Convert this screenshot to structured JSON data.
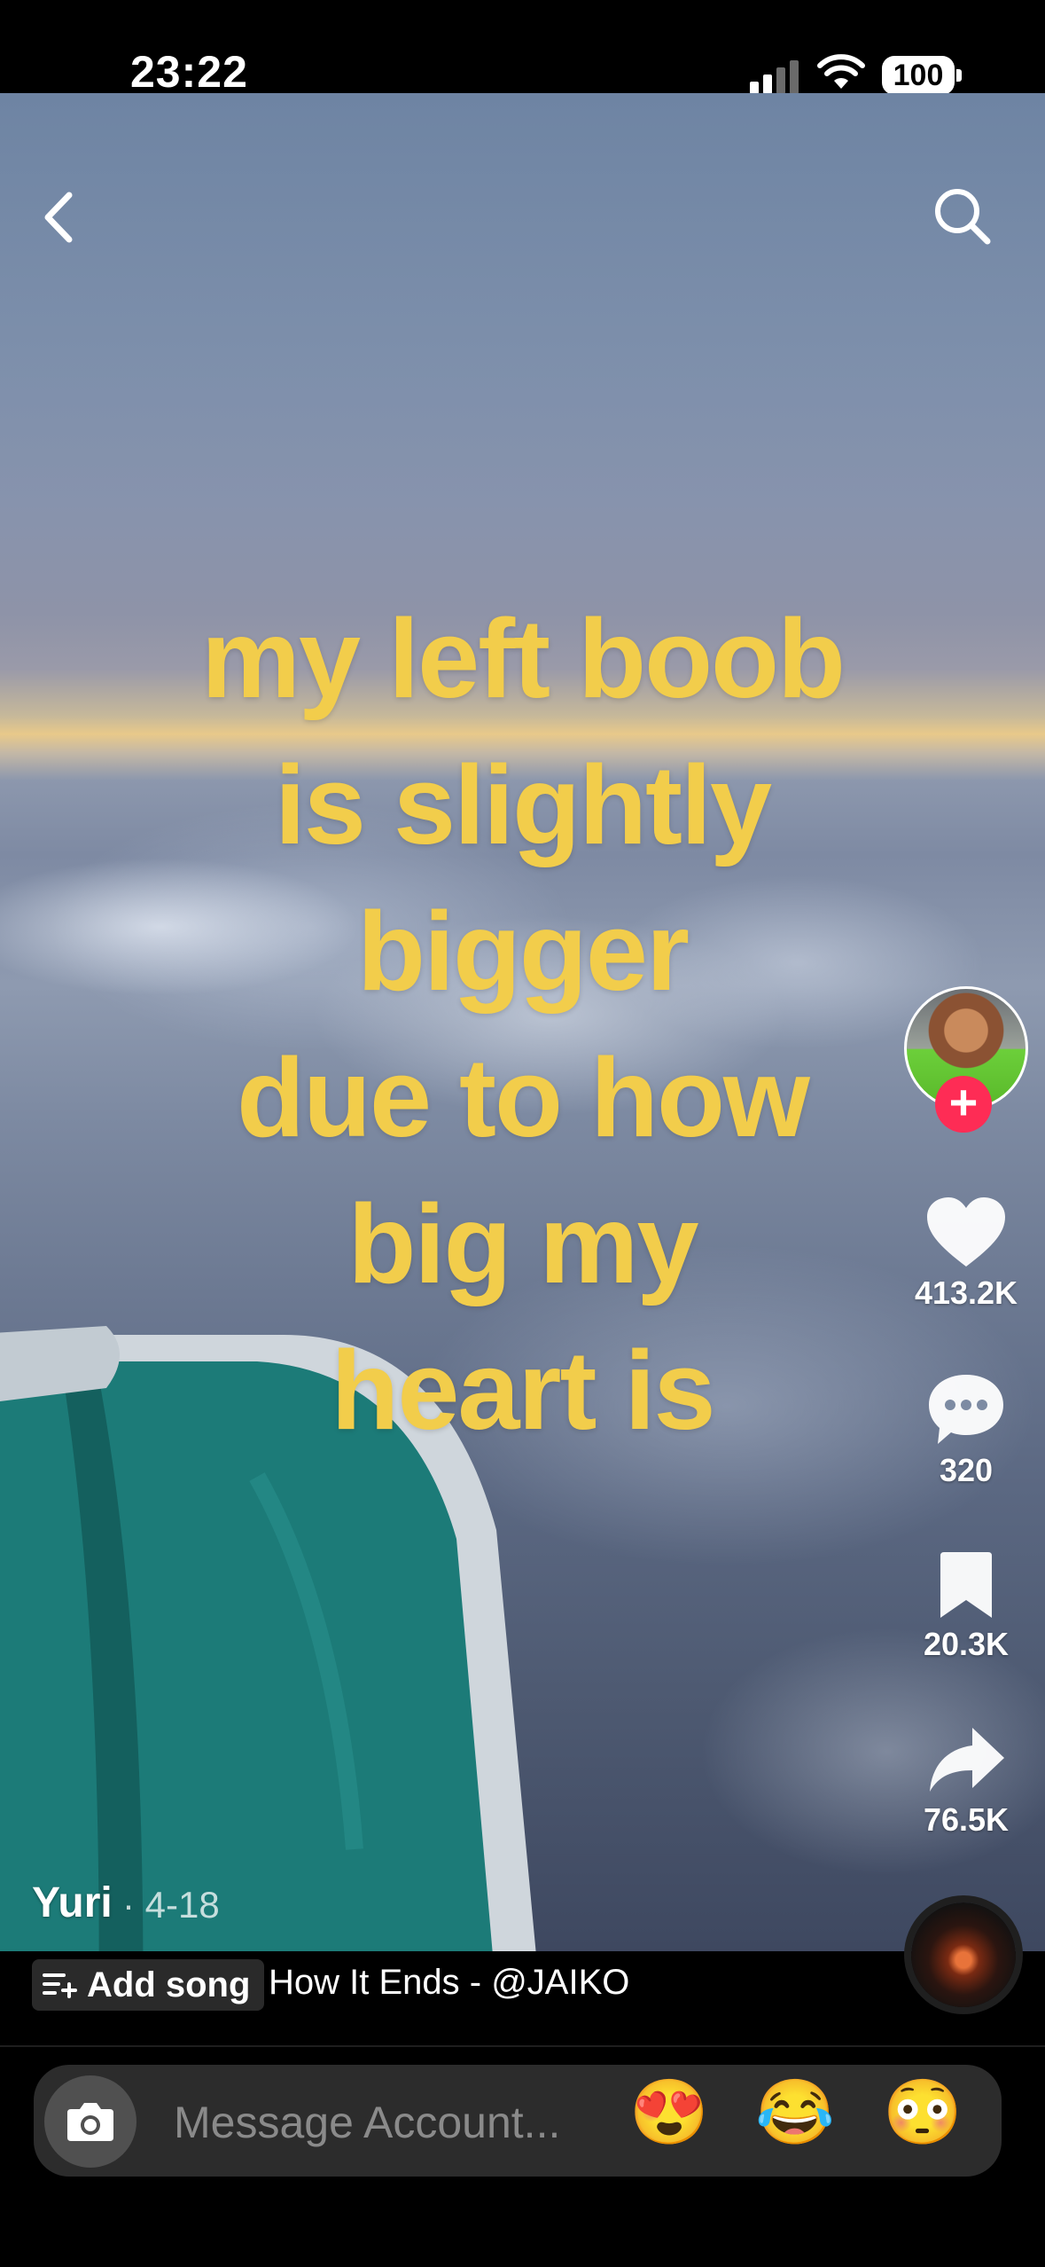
{
  "status_bar": {
    "time": "23:22",
    "battery": "100"
  },
  "top_bar": {
    "back_icon": "chevron-left-icon",
    "search_icon": "search-icon"
  },
  "overlay_text": [
    "my left boob",
    "is slightly",
    "bigger",
    "due to how",
    "big my",
    "heart is"
  ],
  "actions": {
    "likes": "413.2K",
    "comments": "320",
    "saves": "20.3K",
    "shares": "76.5K"
  },
  "post": {
    "author": "Yuri",
    "date": "· 4-18"
  },
  "music": {
    "add_song_label": "Add song",
    "song": "How It Ends - @JAIKO"
  },
  "message": {
    "placeholder": "Message Account...",
    "emojis": [
      "😍",
      "😂",
      "😳"
    ]
  },
  "colors": {
    "overlay_text": "#f2cd4b",
    "follow_button": "#fe2c55"
  }
}
